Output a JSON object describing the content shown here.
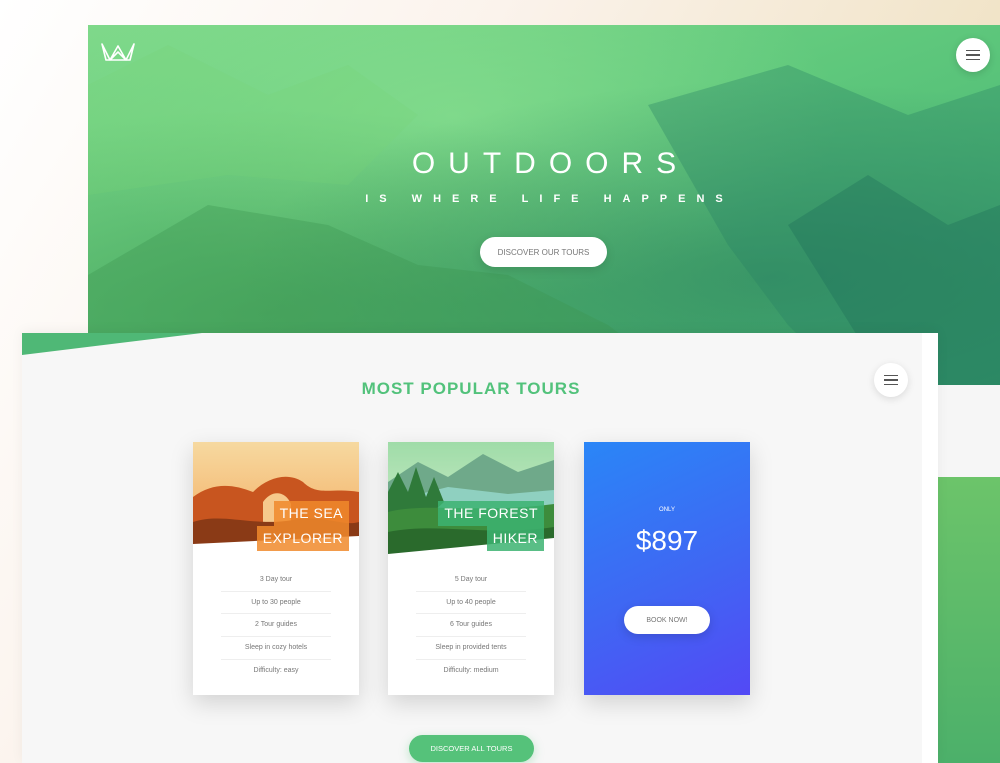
{
  "hero": {
    "title": "OUTDOORS",
    "subtitle": "IS WHERE LIFE HAPPENS",
    "cta_label": "DISCOVER OUR TOURS",
    "logo_icon": "crown-logo-icon",
    "menu_icon": "hamburger-menu-icon"
  },
  "tours": {
    "title": "MOST POPULAR TOURS",
    "menu_icon": "hamburger-menu-icon",
    "cards": [
      {
        "heading_line1": "THE SEA",
        "heading_line2": "EXPLORER",
        "accent": "#f08a2c",
        "details": [
          "3 Day tour",
          "Up to 30 people",
          "2 Tour guides",
          "Sleep in cozy hotels",
          "Difficulty: easy"
        ]
      },
      {
        "heading_line1": "THE FOREST",
        "heading_line2": "HIKER",
        "accent": "#3cb371",
        "details": [
          "5 Day tour",
          "Up to 40 people",
          "6 Tour guides",
          "Sleep in provided tents",
          "Difficulty: medium"
        ]
      }
    ],
    "price_card": {
      "only_label": "ONLY",
      "price": "$897",
      "book_label": "BOOK NOW!"
    },
    "discover_all_label": "DISCOVER ALL TOURS"
  },
  "colors": {
    "green": "#55c27a",
    "blue": "#2a86f7",
    "purple": "#5349f5",
    "orange": "#f08a2c"
  }
}
